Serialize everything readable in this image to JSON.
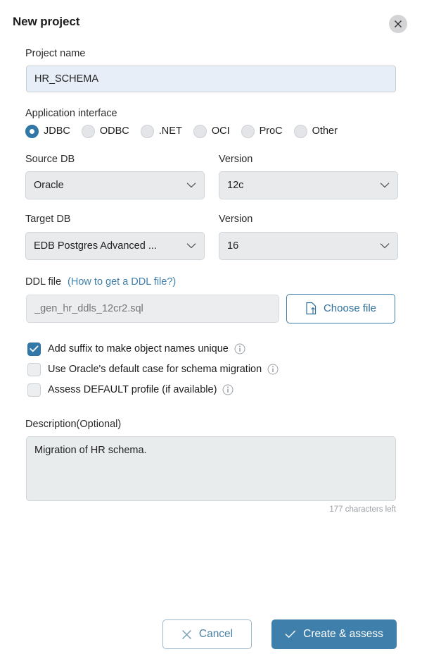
{
  "dialog": {
    "title": "New project",
    "close_icon": "close-icon"
  },
  "project_name": {
    "label": "Project name",
    "value": "HR_SCHEMA",
    "placeholder": "Project name"
  },
  "application_interface": {
    "label": "Application interface",
    "selected": "JDBC",
    "options": [
      {
        "label": "JDBC",
        "selected": true
      },
      {
        "label": "ODBC",
        "selected": false
      },
      {
        "label": ".NET",
        "selected": false
      },
      {
        "label": "OCI",
        "selected": false
      },
      {
        "label": "ProC",
        "selected": false
      },
      {
        "label": "Other",
        "selected": false
      }
    ]
  },
  "source_db": {
    "label": "Source DB",
    "value": "Oracle"
  },
  "source_version": {
    "label": "Version",
    "value": "12c"
  },
  "target_db": {
    "label": "Target DB",
    "value": "EDB Postgres Advanced ..."
  },
  "target_version": {
    "label": "Version",
    "value": "16"
  },
  "ddl_file": {
    "label": "DDL file",
    "help_link": "(How to get a DDL file?)",
    "placeholder": "_gen_hr_ddls_12cr2.sql",
    "value": "",
    "choose_button": "Choose file",
    "choose_icon": "file-upload-icon"
  },
  "checkboxes": [
    {
      "label": "Add suffix to make object names unique",
      "checked": true,
      "info_icon": "info-icon"
    },
    {
      "label": "Use Oracle's default case for schema migration",
      "checked": false,
      "info_icon": "info-icon"
    },
    {
      "label": "Assess DEFAULT profile (if available)",
      "checked": false,
      "info_icon": "info-icon"
    }
  ],
  "description": {
    "label": "Description(Optional)",
    "value": "Migration of HR schema.",
    "placeholder": "",
    "characters_left": "177 characters left"
  },
  "footer": {
    "cancel_label": "Cancel",
    "cancel_icon": "x-icon",
    "submit_label": "Create & assess",
    "submit_icon": "check-icon"
  },
  "colors": {
    "accent_blue": "#3f7fab",
    "control_blue": "#3178a8",
    "link_blue": "#3f7fab",
    "input_focus_bg": "#e7eef8",
    "field_bg": "#e8eaec",
    "muted_text": "#9aa0a6"
  }
}
